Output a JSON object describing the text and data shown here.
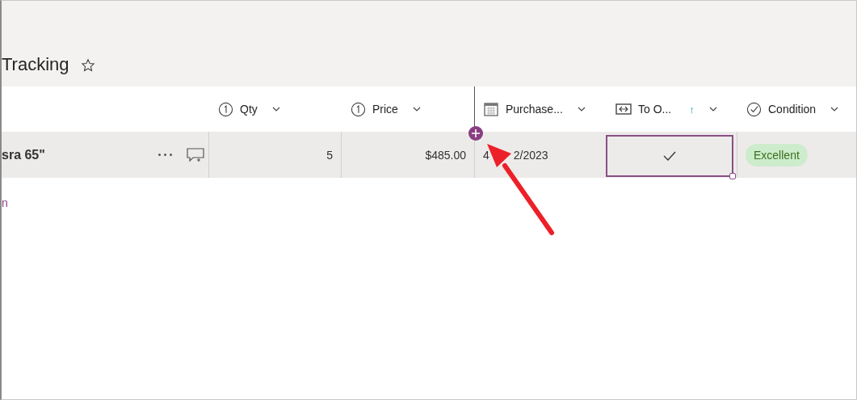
{
  "title": "Tracking",
  "columns": [
    {
      "kind": "name"
    },
    {
      "kind": "number",
      "label": "Qty"
    },
    {
      "kind": "number",
      "label": "Price"
    },
    {
      "kind": "date",
      "label": "Purchase..."
    },
    {
      "kind": "yesno",
      "label": "To O...",
      "sort": "↑"
    },
    {
      "kind": "choice",
      "label": "Condition"
    }
  ],
  "row": {
    "name": "sra 65\"",
    "qty": "5",
    "price": "$485.00",
    "date_parts": [
      "4",
      "2/2023"
    ],
    "to_o": {
      "checked": true,
      "selected": true
    },
    "condition": {
      "label": "Excellent",
      "color": "#cdeccc"
    }
  },
  "link": "n"
}
